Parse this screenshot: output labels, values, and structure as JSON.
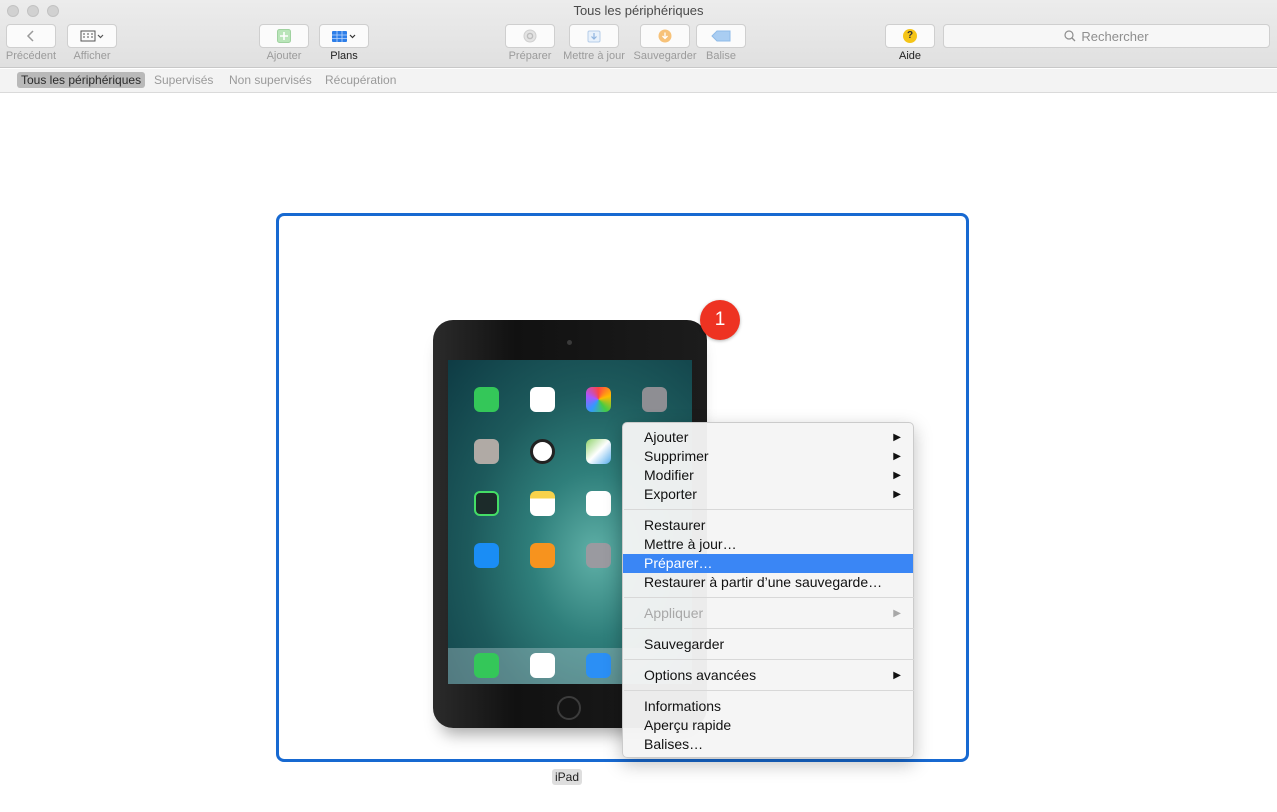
{
  "window": {
    "title": "Tous les périphériques"
  },
  "toolbar": {
    "back_label": "Précédent",
    "view_label": "Afficher",
    "add_label": "Ajouter",
    "plans_label": "Plans",
    "prepare_label": "Préparer",
    "update_label": "Mettre à jour",
    "backup_label": "Sauvegarder",
    "tag_label": "Balise",
    "help_label": "Aide",
    "help_glyph": "?",
    "search_placeholder": "Rechercher"
  },
  "filters": [
    {
      "label": "Tous les périphériques",
      "active": true
    },
    {
      "label": "Supervisés",
      "active": false
    },
    {
      "label": "Non supervisés",
      "active": false
    },
    {
      "label": "Récupération",
      "active": false
    }
  ],
  "device": {
    "name": "iPad",
    "badge_count": "1"
  },
  "context_menu": {
    "items": [
      {
        "label": "Ajouter",
        "submenu": true
      },
      {
        "label": "Supprimer",
        "submenu": true
      },
      {
        "label": "Modifier",
        "submenu": true
      },
      {
        "label": "Exporter",
        "submenu": true
      },
      {
        "label": "Restaurer"
      },
      {
        "label": "Mettre à jour…"
      },
      {
        "label": "Préparer…",
        "selected": true
      },
      {
        "label": "Restaurer à partir d’une sauvegarde…"
      },
      {
        "label": "Appliquer",
        "submenu": true,
        "disabled": true
      },
      {
        "label": "Sauvegarder"
      },
      {
        "label": "Options avancées",
        "submenu": true
      },
      {
        "label": "Informations"
      },
      {
        "label": "Aperçu rapide"
      },
      {
        "label": "Balises…"
      }
    ],
    "submenu_arrow": "▶"
  },
  "colors": {
    "accent": "#1769d1",
    "selection": "#3a86f5",
    "badge": "#ee3322"
  }
}
